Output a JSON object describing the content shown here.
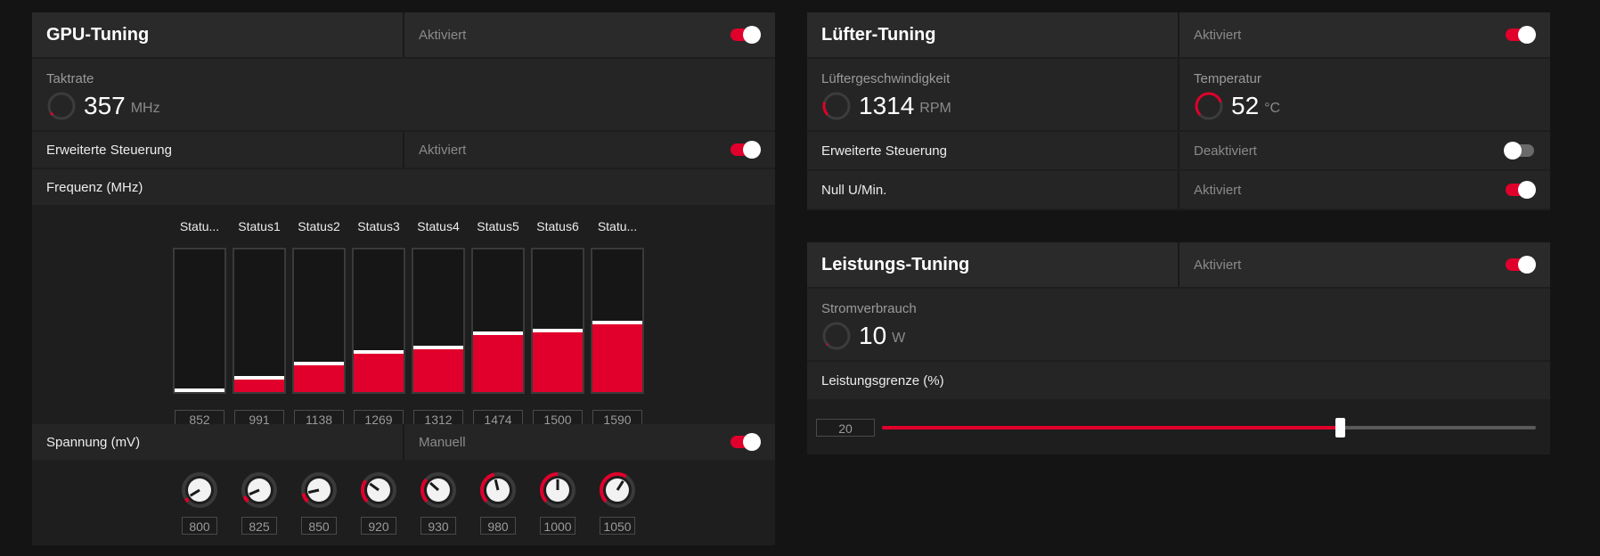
{
  "gpu": {
    "title": "GPU-Tuning",
    "status": "Aktiviert",
    "clock": {
      "label": "Taktrate",
      "value": "357",
      "unit": "MHz"
    },
    "advanced": {
      "label": "Erweiterte Steuerung",
      "status": "Aktiviert"
    },
    "frequency": {
      "label": "Frequenz (MHz)",
      "states": [
        {
          "name": "Statu...",
          "value": "852",
          "level": 0.0
        },
        {
          "name": "Status1",
          "value": "991",
          "level": 0.1
        },
        {
          "name": "Status2",
          "value": "1138",
          "level": 0.2
        },
        {
          "name": "Status3",
          "value": "1269",
          "level": 0.28
        },
        {
          "name": "Status4",
          "value": "1312",
          "level": 0.31
        },
        {
          "name": "Status5",
          "value": "1474",
          "level": 0.41
        },
        {
          "name": "Status6",
          "value": "1500",
          "level": 0.43
        },
        {
          "name": "Statu...",
          "value": "1590",
          "level": 0.49
        }
      ]
    },
    "voltage": {
      "label": "Spannung (mV)",
      "status": "Manuell",
      "knobs": [
        {
          "value": "800",
          "level": 0.05
        },
        {
          "value": "825",
          "level": 0.08
        },
        {
          "value": "850",
          "level": 0.12
        },
        {
          "value": "920",
          "level": 0.3
        },
        {
          "value": "930",
          "level": 0.32
        },
        {
          "value": "980",
          "level": 0.45
        },
        {
          "value": "1000",
          "level": 0.5
        },
        {
          "value": "1050",
          "level": 0.62
        }
      ]
    }
  },
  "fan": {
    "title": "Lüfter-Tuning",
    "status": "Aktiviert",
    "speed": {
      "label": "Lüftergeschwindigkeit",
      "value": "1314",
      "unit": "RPM"
    },
    "temp": {
      "label": "Temperatur",
      "value": "52",
      "unit": "°C"
    },
    "advanced": {
      "label": "Erweiterte Steuerung",
      "status": "Deaktiviert"
    },
    "zero_rpm": {
      "label": "Null U/Min.",
      "status": "Aktiviert"
    }
  },
  "power": {
    "title": "Leistungs-Tuning",
    "status": "Aktiviert",
    "consumption": {
      "label": "Stromverbrauch",
      "value": "10",
      "unit": "W"
    },
    "limit": {
      "label": "Leistungsgrenze (%)",
      "value": "20",
      "level": 0.7
    }
  },
  "colors": {
    "accent": "#e0002b",
    "panel": "#1e1e1e",
    "row": "#252525"
  }
}
